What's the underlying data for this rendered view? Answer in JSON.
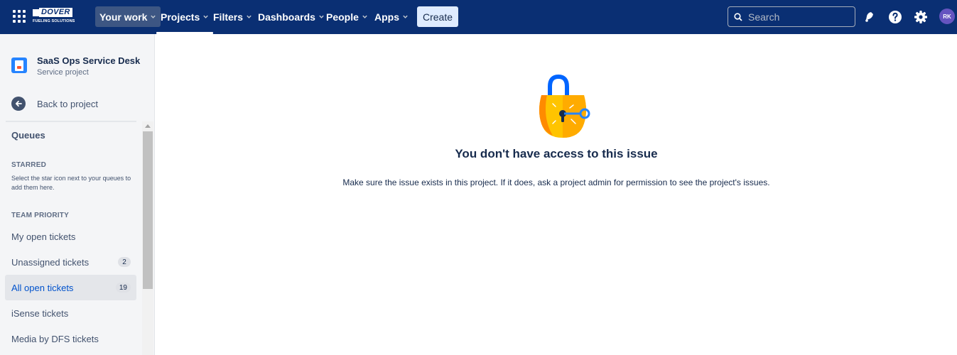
{
  "topnav": {
    "logo": {
      "word": "DOVER",
      "sub": "FUELING SOLUTIONS"
    },
    "items": [
      {
        "label": "Your work"
      },
      {
        "label": "Projects"
      },
      {
        "label": "Filters"
      },
      {
        "label": "Dashboards"
      },
      {
        "label": "People"
      },
      {
        "label": "Apps"
      }
    ],
    "create_label": "Create",
    "search_placeholder": "Search",
    "avatar_initials": "RK",
    "colors": {
      "background": "#0a2f73",
      "create_bg": "#deebff",
      "avatar": "#6554c0"
    }
  },
  "sidebar": {
    "project_name": "SaaS Ops Service Desk",
    "project_type": "Service project",
    "back_label": "Back to project",
    "queues_label": "Queues",
    "starred_heading": "STARRED",
    "starred_help": "Select the star icon next to your queues to add them here.",
    "team_priority_heading": "TEAM PRIORITY",
    "items": [
      {
        "label": "My open tickets",
        "count": ""
      },
      {
        "label": "Unassigned tickets",
        "count": "2"
      },
      {
        "label": "All open tickets",
        "count": "19"
      },
      {
        "label": "iSense tickets",
        "count": ""
      },
      {
        "label": "Media by DFS tickets",
        "count": ""
      }
    ],
    "selected_item": "All open tickets"
  },
  "main": {
    "title": "You don't have access to this issue",
    "description": "Make sure the issue exists in this project. If it does, ask a project admin for permission to see the project's issues.",
    "illustration": "padlock-with-key-icon"
  }
}
